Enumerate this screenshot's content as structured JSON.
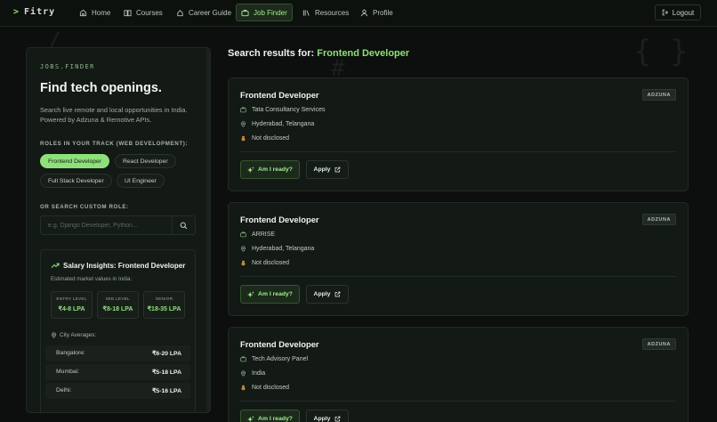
{
  "app": {
    "logo_prompt": ">",
    "logo_name": "Fitry"
  },
  "nav": {
    "items": [
      {
        "label": "Home",
        "icon": "home-icon"
      },
      {
        "label": "Courses",
        "icon": "book-icon"
      },
      {
        "label": "Career Guide",
        "icon": "compass-icon"
      },
      {
        "label": "Job Finder",
        "icon": "briefcase-icon",
        "active": true
      },
      {
        "label": "Resources",
        "icon": "library-icon"
      },
      {
        "label": "Profile",
        "icon": "user-icon"
      }
    ],
    "logout_label": "Logout"
  },
  "sidebar": {
    "eyebrow": "JOBS.FINDER",
    "heading": "Find tech openings.",
    "description": "Search live remote and local opportunities in India. Powered by Adzuna & Remotive APIs.",
    "roles_label": "ROLES IN YOUR TRACK (WEB DEVELOPMENT):",
    "roles": [
      "Frontend Developer",
      "React Developer",
      "Full Stack Developer",
      "UI Engineer"
    ],
    "active_role": "Frontend Developer",
    "custom_label": "OR SEARCH CUSTOM ROLE:",
    "search_placeholder": "e.g. Django Developer, Python...",
    "search_value": ""
  },
  "insights": {
    "title": "Salary Insights: Frontend Developer",
    "subtitle": "Estimated market values in India:",
    "levels": [
      {
        "label": "ENTRY LEVEL",
        "value": "₹4-8 LPA"
      },
      {
        "label": "MID LEVEL",
        "value": "₹8-18 LPA"
      },
      {
        "label": "SENIOR",
        "value": "₹18-35 LPA"
      }
    ],
    "city_heading": "City Averages:",
    "cities": [
      {
        "name": "Bangalore:",
        "value": "₹6-20 LPA"
      },
      {
        "name": "Mumbai:",
        "value": "₹5-18 LPA"
      },
      {
        "name": "Delhi:",
        "value": "₹5-16 LPA"
      }
    ]
  },
  "results": {
    "prefix": "Search results for:",
    "query": "Frontend Developer",
    "jobs": [
      {
        "title": "Frontend Developer",
        "source": "ADZUNA",
        "company": "Tata Consultancy Services",
        "location": "Hyderabad, Telangana",
        "salary": "Not disclosed",
        "ready_label": "Am I ready?",
        "apply_label": "Apply"
      },
      {
        "title": "Frontend Developer",
        "source": "ADZUNA",
        "company": "ARRISE",
        "location": "Hyderabad, Telangana",
        "salary": "Not disclosed",
        "ready_label": "Am I ready?",
        "apply_label": "Apply"
      },
      {
        "title": "Frontend Developer",
        "source": "ADZUNA",
        "company": "Tech Advisory Panel",
        "location": "India",
        "salary": "Not disclosed",
        "ready_label": "Am I ready?",
        "apply_label": "Apply"
      }
    ]
  },
  "colors": {
    "accent": "#8ee07a",
    "background": "#0c0f0d",
    "panel": "#131915"
  }
}
